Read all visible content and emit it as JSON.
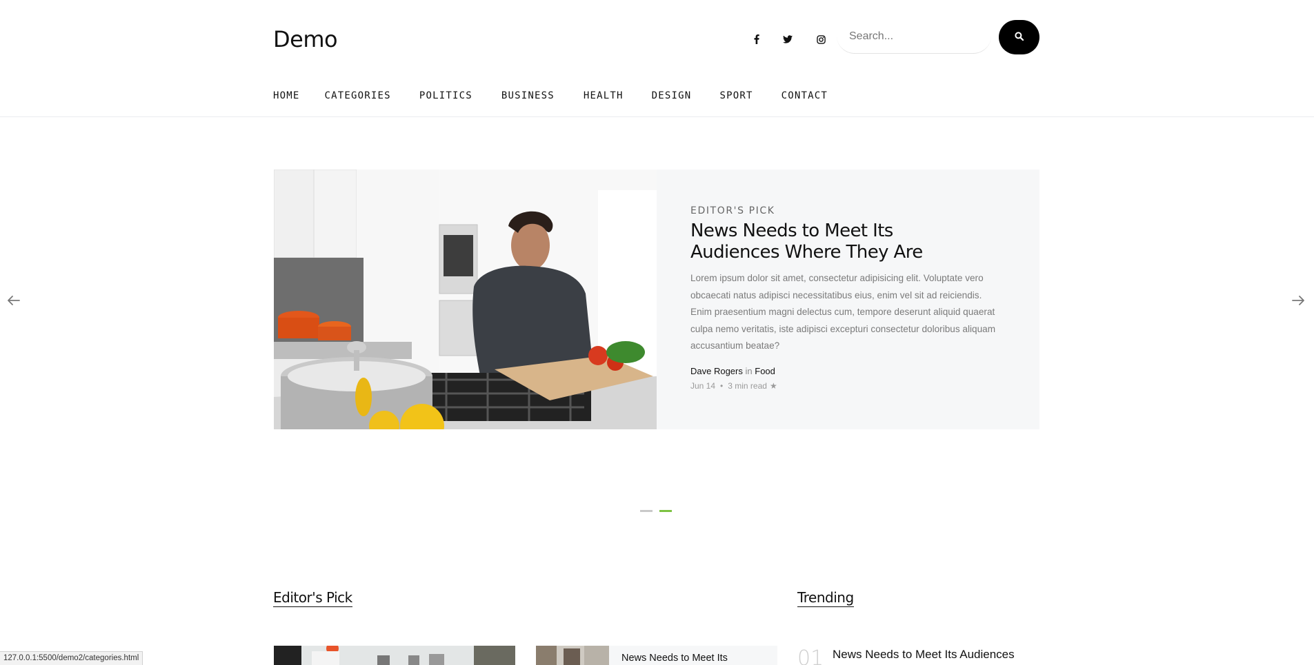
{
  "header": {
    "logo": "Demo",
    "search_placeholder": "Search...",
    "social": [
      {
        "icon": "facebook-icon"
      },
      {
        "icon": "twitter-icon"
      },
      {
        "icon": "instagram-icon"
      }
    ]
  },
  "nav": {
    "items": [
      "HOME",
      "CATEGORIES",
      "POLITICS",
      "BUSINESS",
      "HEALTH",
      "DESIGN",
      "SPORT",
      "CONTACT"
    ]
  },
  "hero": {
    "kicker": "EDITOR'S PICK",
    "title": "News Needs to Meet Its Audiences Where They Are",
    "excerpt": "Lorem ipsum dolor sit amet, consectetur adipisicing elit. Voluptate vero obcaecati natus adipisci necessitatibus eius, enim vel sit ad reiciendis. Enim praesentium magni delectus cum, tempore deserunt aliquid quaerat culpa nemo veritatis, iste adipisci excepturi consectetur doloribus aliquam accusantium beatae?",
    "author": "Dave Rogers",
    "in_label": "in",
    "category": "Food",
    "date": "Jun 14",
    "separator": "•",
    "read_time": "3 min read",
    "star": "★"
  },
  "slider": {
    "slide_count": 2,
    "active_index": 1
  },
  "editors_pick": {
    "title": "Editor's Pick",
    "card2_title": "News Needs to Meet Its"
  },
  "trending": {
    "title": "Trending",
    "items": [
      {
        "num": "01",
        "title": "News Needs to Meet Its Audiences Where They Are"
      }
    ]
  },
  "status_bar": {
    "url": "127.0.0.1:5500/demo2/categories.html"
  },
  "colors": {
    "accent": "#7dc242",
    "card_bg": "#f6f7f8",
    "dot_inactive": "#c9c9c9"
  }
}
